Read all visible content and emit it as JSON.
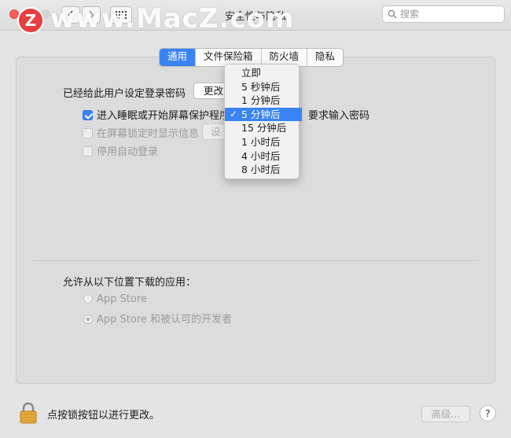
{
  "window": {
    "title": "安全性与隐私",
    "watermark": "www.MacZ.com",
    "logo_letter": "Z"
  },
  "toolbar": {
    "back_icon": "chevron-left-icon",
    "forward_icon": "chevron-right-icon",
    "grid_icon": "grid-icon"
  },
  "search": {
    "placeholder": "搜索"
  },
  "tabs": [
    {
      "label": "通用",
      "active": true
    },
    {
      "label": "文件保险箱",
      "active": false
    },
    {
      "label": "防火墙",
      "active": false
    },
    {
      "label": "隐私",
      "active": false
    }
  ],
  "general": {
    "password_set_label": "已经给此用户设定登录密码",
    "change_password_button": "更改",
    "sleep_checkbox": {
      "label": "进入睡眠或开始屏幕保护程序",
      "checked": true
    },
    "require_password_label": "要求输入密码",
    "lock_message_checkbox": {
      "label": "在屏幕锁定时显示信息",
      "checked": false
    },
    "set_message_button": "设",
    "auto_login_checkbox": {
      "label": "停用自动登录",
      "checked": false
    }
  },
  "dropdown": {
    "options": [
      "立即",
      "5 秒钟后",
      "1 分钟后",
      "5 分钟后",
      "15 分钟后",
      "1 小时后",
      "4 小时后",
      "8 小时后"
    ],
    "selected_index": 3
  },
  "downloads": {
    "label": "允许从以下位置下载的应用：",
    "options": [
      {
        "label": "App Store",
        "selected": false
      },
      {
        "label": "App Store 和被认可的开发者",
        "selected": true
      }
    ]
  },
  "footer": {
    "lock_label": "点按锁按钮以进行更改。",
    "advanced_button": "高级...",
    "help_button": "?"
  },
  "colors": {
    "accent": "#3a83f5",
    "close": "#fc605c",
    "logo": "#e83e3e"
  }
}
